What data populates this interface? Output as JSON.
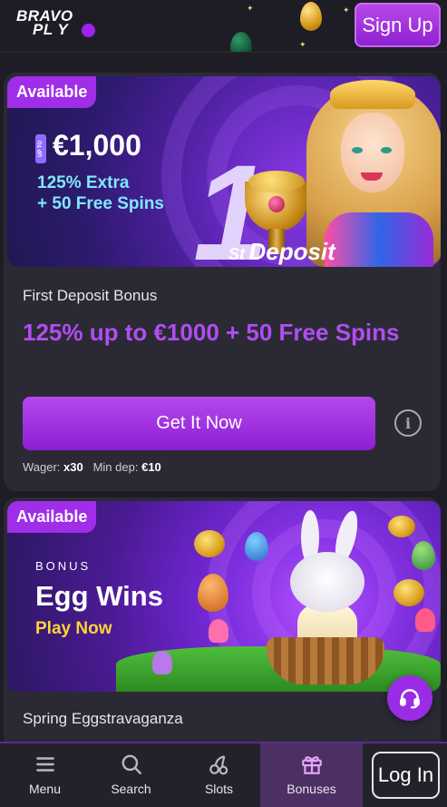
{
  "header": {
    "logo_line1": "BRAVO",
    "logo_line2": "PL Y",
    "signup_label": "Sign Up"
  },
  "promotions": [
    {
      "badge": "Available",
      "banner": {
        "up_to": "UP TO",
        "amount": "€1,000",
        "extra_line1": "125% Extra",
        "extra_line2": "+ 50 Free Spins",
        "big_number": "1",
        "deposit_ordinal": "St",
        "deposit_word": "Deposit"
      },
      "subtitle": "First Deposit Bonus",
      "title": "125% up to €1000 + 50 Free Spins",
      "cta_label": "Get It Now",
      "info_icon": "i",
      "wager_label": "Wager:",
      "wager_value": "x30",
      "min_dep_label": "Min dep:",
      "min_dep_value": "€10"
    },
    {
      "badge": "Available",
      "banner": {
        "bonus_label": "BONUS",
        "title": "Egg Wins",
        "play_label": "Play Now"
      },
      "subtitle": "Spring Eggstravaganza"
    }
  ],
  "bottom_nav": {
    "items": [
      {
        "label": "Menu",
        "icon": "hamburger-icon"
      },
      {
        "label": "Search",
        "icon": "search-icon"
      },
      {
        "label": "Slots",
        "icon": "cherries-icon"
      },
      {
        "label": "Bonuses",
        "icon": "gift-icon",
        "active": true
      }
    ],
    "login_label": "Log In"
  },
  "colors": {
    "accent": "#a02de8",
    "background": "#1e1d26",
    "card": "#2b2a34",
    "title_purple": "#b14df2",
    "cyan_text": "#7fe8ff",
    "yellow_text": "#ffd23a"
  }
}
